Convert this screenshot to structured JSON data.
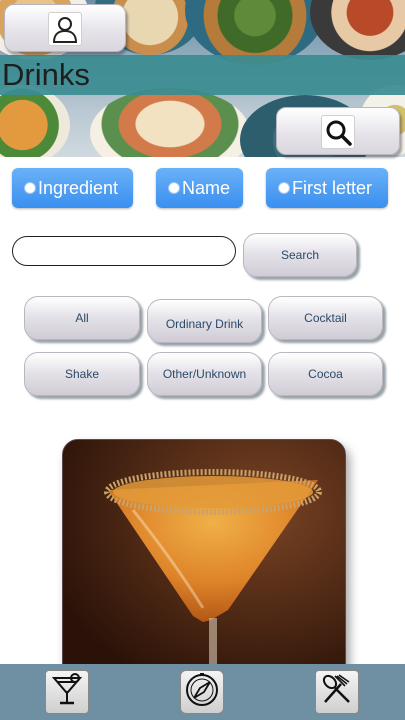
{
  "header": {
    "title": "Drinks",
    "user_icon": "user-icon",
    "search_icon": "search-icon"
  },
  "search_mode": {
    "options": [
      "Ingredient",
      "Name",
      "First letter"
    ]
  },
  "search": {
    "input_value": "",
    "button_label": "Search"
  },
  "categories": {
    "all": "All",
    "ordinary_drink": "Ordinary Drink",
    "cocktail": "Cocktail",
    "shake": "Shake",
    "other_unknown": "Other/Unknown",
    "cocoa": "Cocoa"
  },
  "bottom_nav": {
    "icons": [
      "cocktail-glass-icon",
      "compass-icon",
      "fork-spoon-icon"
    ]
  },
  "colors": {
    "title_bar": "#3a8c91",
    "radio_pill": "#3a8ff0",
    "bottom_nav": "#6f8fa3",
    "button_text": "#2a4a6a"
  }
}
